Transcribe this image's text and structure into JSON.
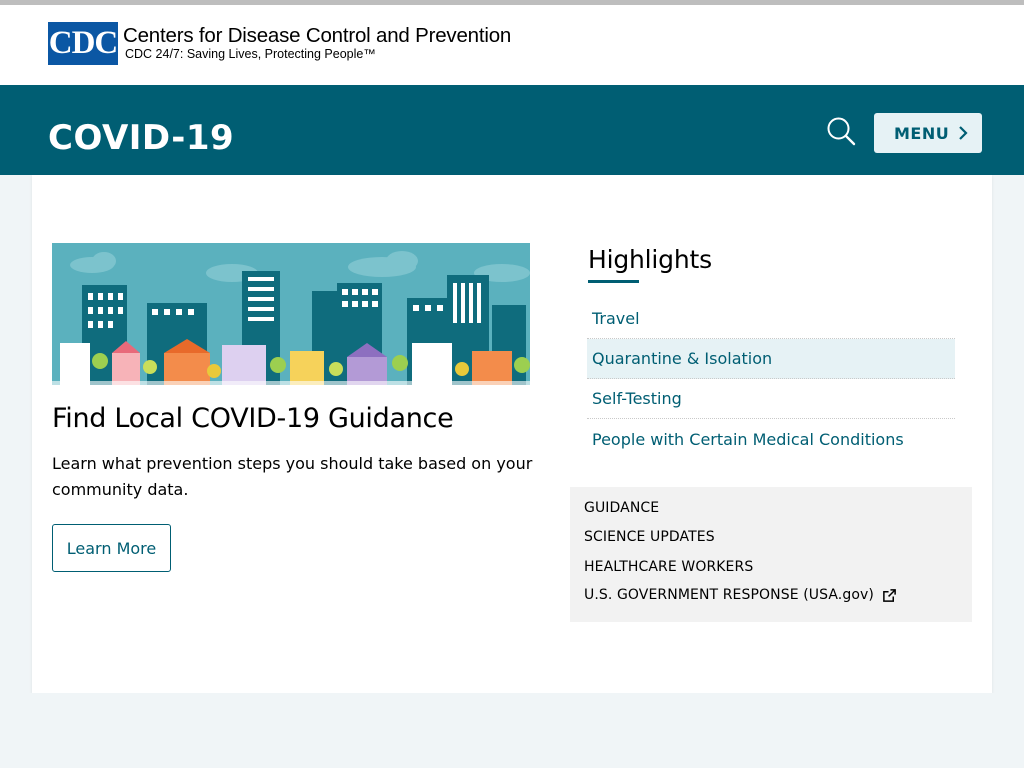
{
  "header": {
    "logo_mark": "CDC",
    "logo_name": "Centers for Disease Control and Prevention",
    "logo_tagline": "CDC 24/7: Saving Lives, Protecting People™"
  },
  "topic_bar": {
    "title": "COVID-19",
    "search_icon": "search-icon",
    "menu_label": "MENU",
    "menu_icon": "chevron-right-icon"
  },
  "feature": {
    "image": "city-skyline-illustration",
    "title": "Find Local COVID-19 Guidance",
    "description": "Learn what prevention steps you should take based on your community data.",
    "button_label": "Learn More"
  },
  "highlights": {
    "title": "Highlights",
    "items": [
      {
        "label": "Travel"
      },
      {
        "label": "Quarantine & Isolation"
      },
      {
        "label": "Self-Testing"
      },
      {
        "label": "People with Certain Medical Conditions"
      }
    ]
  },
  "quick_links": [
    {
      "label": "GUIDANCE"
    },
    {
      "label": "SCIENCE UPDATES"
    },
    {
      "label": "HEALTHCARE WORKERS"
    },
    {
      "label": "U.S. GOVERNMENT RESPONSE (USA.gov)",
      "icon": "external-link-icon"
    }
  ],
  "lower_section": {
    "heading": ""
  },
  "colors": {
    "brand_teal": "#005e73",
    "cdc_blue": "#0b57a4",
    "highlight_bg": "#e6f2f5"
  }
}
